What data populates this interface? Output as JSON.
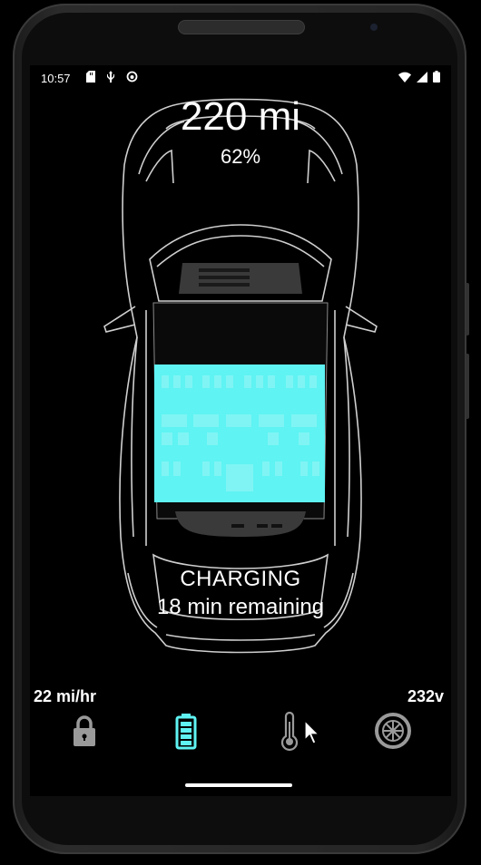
{
  "status_bar": {
    "time": "10:57",
    "left_icons": [
      "sd-card-icon",
      "usb-icon",
      "sync-icon"
    ],
    "right_icons": [
      "wifi-icon",
      "cell-signal-icon",
      "battery-icon"
    ]
  },
  "vehicle": {
    "range": "220 mi",
    "battery_percent": "62%",
    "state": "CHARGING",
    "time_remaining": "18 min remaining",
    "charge_rate": "22 mi/hr",
    "voltage": "232v"
  },
  "nav": [
    {
      "name": "lock",
      "icon": "lock-icon",
      "active": false
    },
    {
      "name": "battery",
      "icon": "battery-icon",
      "active": true
    },
    {
      "name": "temperature",
      "icon": "thermometer-icon",
      "active": false
    },
    {
      "name": "tires",
      "icon": "tire-icon",
      "active": false
    }
  ],
  "colors": {
    "accent": "#5ff3f3",
    "inactive_icon": "#9a9a9a",
    "background": "#000000",
    "car_outline": "#cfcfcf"
  }
}
